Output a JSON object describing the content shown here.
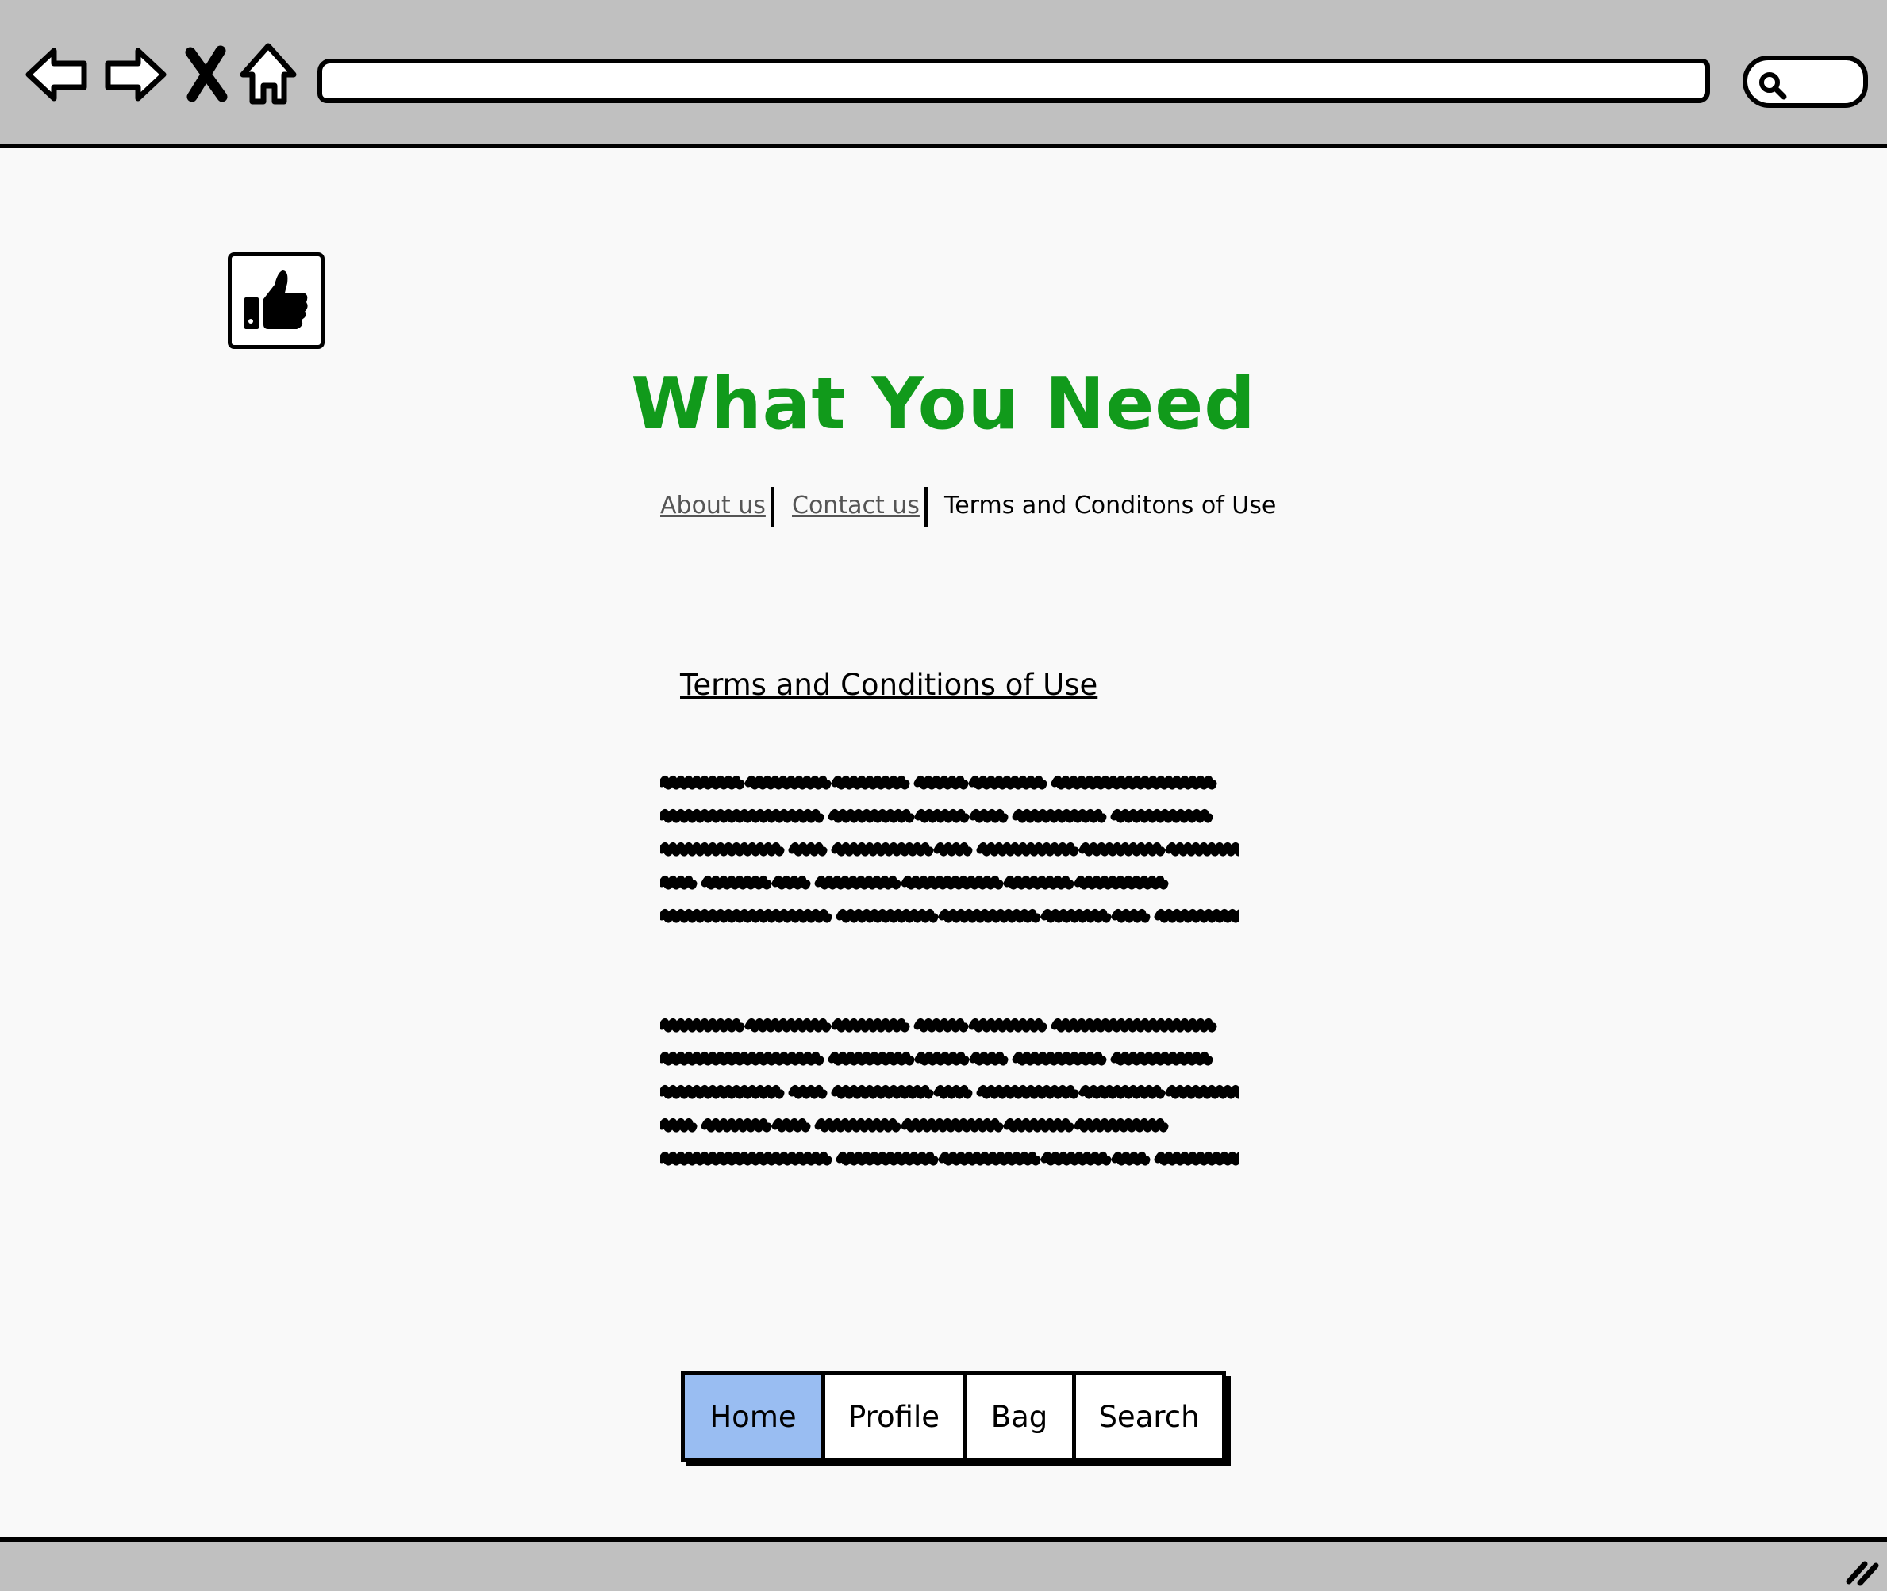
{
  "browser": {
    "url_value": "",
    "search_value": ""
  },
  "site": {
    "title": "What You Need",
    "title_color": "#119a1b",
    "logo_icon": "thumbs-up-icon"
  },
  "top_links": [
    {
      "label": "About us",
      "state": "link"
    },
    {
      "label": "Contact us",
      "state": "link"
    },
    {
      "label": "Terms and Conditons of Use",
      "state": "current"
    }
  ],
  "content": {
    "heading": "Terms and Conditions of Use",
    "paragraphs": [
      {
        "lines": 5
      },
      {
        "lines": 5
      }
    ]
  },
  "tabs": [
    {
      "label": "Home",
      "active": true
    },
    {
      "label": "Profile",
      "active": false
    },
    {
      "label": "Bag",
      "active": false
    },
    {
      "label": "Search",
      "active": false
    }
  ],
  "colors": {
    "active_tab": "#99bdf2",
    "chrome": "#c0c0c0"
  }
}
